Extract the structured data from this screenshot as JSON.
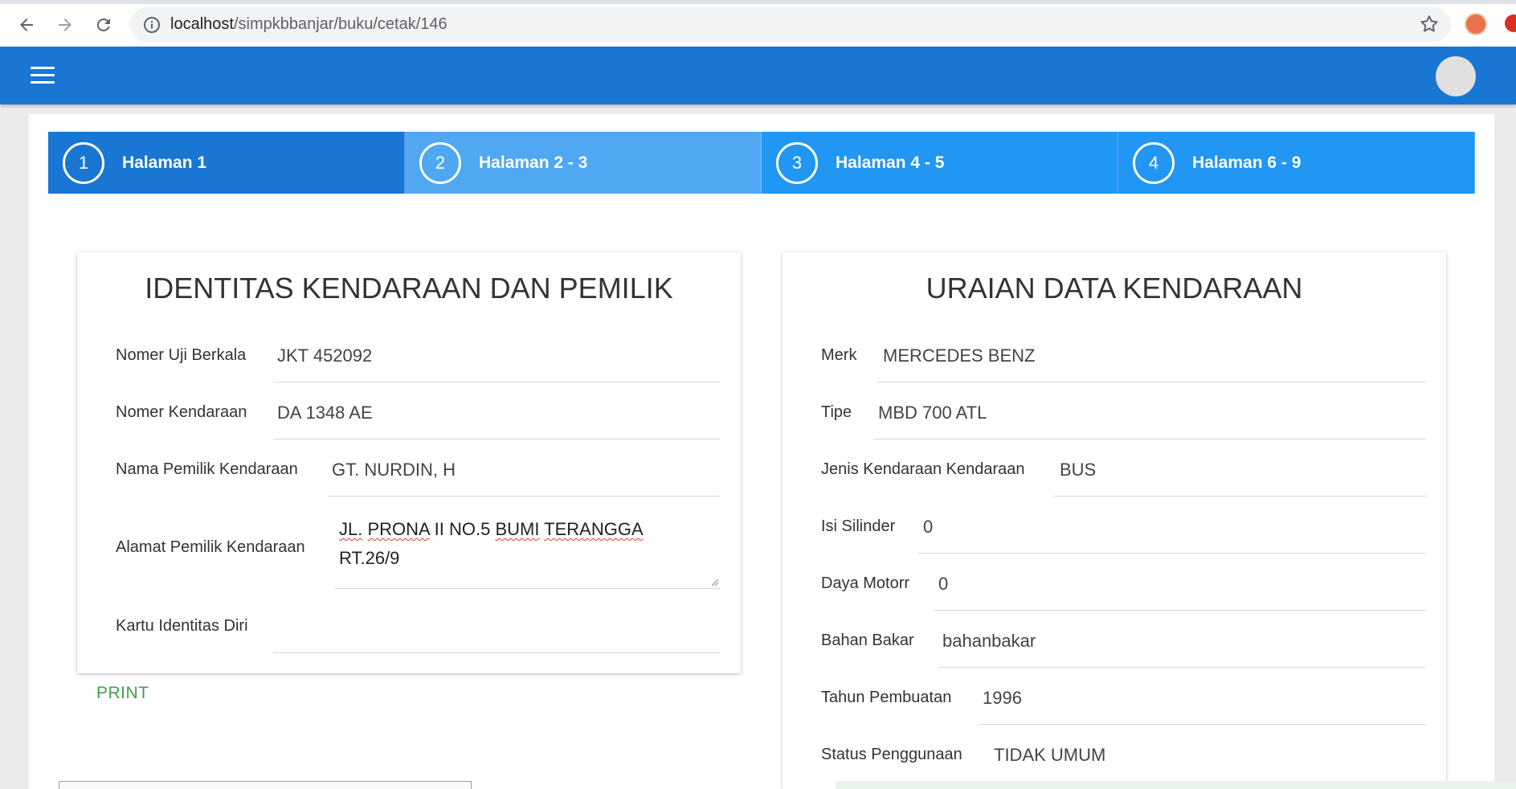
{
  "browser": {
    "url_host": "localhost",
    "url_path": "/simpkbbanjar/buku/cetak/146"
  },
  "steps": [
    {
      "number": "1",
      "label": "Halaman 1",
      "color": "#1976d2"
    },
    {
      "number": "2",
      "label": "Halaman 2 - 3",
      "color": "#4fa8f1"
    },
    {
      "number": "3",
      "label": "Halaman 4 - 5",
      "color": "#2196f3"
    },
    {
      "number": "4",
      "label": "Halaman 6 - 9",
      "color": "#2196f3"
    }
  ],
  "identity_panel": {
    "title": "IDENTITAS KENDARAAN DAN PEMILIK",
    "fields": {
      "nomer_uji": {
        "label": "Nomer Uji Berkala",
        "value": "JKT 452092"
      },
      "nomer_kendaraan": {
        "label": "Nomer Kendaraan",
        "value": "DA 1348 AE"
      },
      "nama_pemilik": {
        "label": "Nama Pemilik Kendaraan",
        "value": "GT. NURDIN, H"
      },
      "alamat_pemilik": {
        "label": "Alamat Pemilik Kendaraan",
        "line1_a": "JL.",
        "line1_b": "PRONA",
        "line1_c": "II NO.5",
        "line1_d": "BUMI",
        "line1_e": "TERANGGA",
        "line2": "RT.26/9"
      },
      "kartu_identitas": {
        "label": "Kartu Identitas Diri",
        "value": ""
      }
    }
  },
  "print_label": "PRINT",
  "vehicle_panel": {
    "title": "URAIAN DATA KENDARAAN",
    "fields": {
      "merk": {
        "label": "Merk",
        "value": "MERCEDES BENZ"
      },
      "tipe": {
        "label": "Tipe",
        "value": "MBD 700 ATL"
      },
      "jenis": {
        "label": "Jenis Kendaraan Kendaraan",
        "value": "BUS"
      },
      "isi_silinder": {
        "label": "Isi Silinder",
        "value": "0"
      },
      "daya_motor": {
        "label": "Daya Motorr",
        "value": "0"
      },
      "bahan_bakar": {
        "label": "Bahan Bakar",
        "value": "bahanbakar"
      },
      "tahun_pembuatan": {
        "label": "Tahun Pembuatan",
        "value": "1996"
      },
      "status_penggunaan": {
        "label": "Status Penggunaan",
        "value": "TIDAK UMUM"
      }
    }
  },
  "colors": {
    "appbar": "#1976d2",
    "print": "#43a047"
  }
}
